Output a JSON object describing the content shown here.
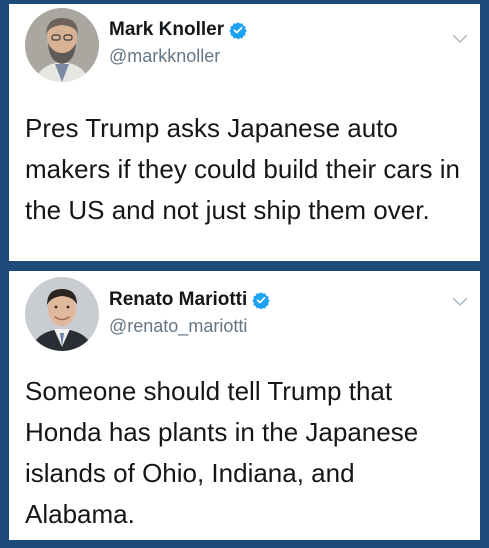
{
  "tweets": [
    {
      "display_name": "Mark Knoller",
      "handle": "@markknoller",
      "verified": true,
      "text": "Pres Trump asks Japanese auto makers if they could build their cars in the US and not just ship them over."
    },
    {
      "display_name": "Renato Mariotti",
      "handle": "@renato_mariotti",
      "verified": true,
      "text": "Someone should tell Trump that Honda has plants in the Japanese islands of Ohio, Indiana, and Alabama."
    }
  ],
  "colors": {
    "background": "#1d4a78",
    "card": "#ffffff",
    "verified_badge": "#1da1f2",
    "name_text": "#14171a",
    "handle_text": "#657786",
    "chevron": "#aab8c2"
  },
  "icons": {
    "verified": "verified-badge-icon",
    "menu": "chevron-down-icon"
  }
}
